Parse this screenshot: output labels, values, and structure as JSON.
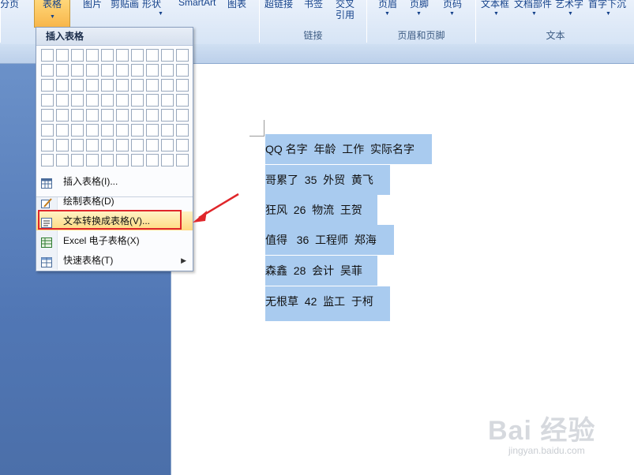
{
  "ribbon": {
    "top_labels": [
      "分页",
      "表格",
      "图片",
      "剪贴画",
      "形状",
      "SmartArt",
      "图表",
      "超链接",
      "书签",
      "交叉",
      "页眉",
      "页脚",
      "页码",
      "文本框",
      "文档部件",
      "艺术字",
      "首字下沉"
    ],
    "cross_ref_second": "引用",
    "groups": [
      "链接",
      "页眉和页脚",
      "文本"
    ]
  },
  "menu": {
    "title": "插入表格",
    "items": [
      {
        "label": "插入表格(I)...",
        "icon": "insert-table-icon"
      },
      {
        "label": "绘制表格(D)",
        "icon": "draw-table-icon"
      },
      {
        "label": "文本转换成表格(V)...",
        "icon": "text-to-table-icon"
      },
      {
        "label": "Excel 电子表格(X)",
        "icon": "excel-icon"
      },
      {
        "label": "快速表格(T)",
        "icon": "quick-table-icon"
      }
    ]
  },
  "document": {
    "lines": [
      "QQ 名字  年龄  工作  实际名字",
      "哥累了  35  外贸  黄飞",
      "狂风  26  物流  王贺",
      "值得   36  工程师  郑海",
      "森鑫  28  会计  吴菲",
      "无根草  42  监工  于柯"
    ]
  },
  "watermark": {
    "brand": "Bai 经验",
    "url": "jingyan.baidu.com"
  },
  "colors": {
    "highlight": "#a9cbef",
    "red_annotation": "#e0262a",
    "menu_hover": "#ffd980"
  }
}
